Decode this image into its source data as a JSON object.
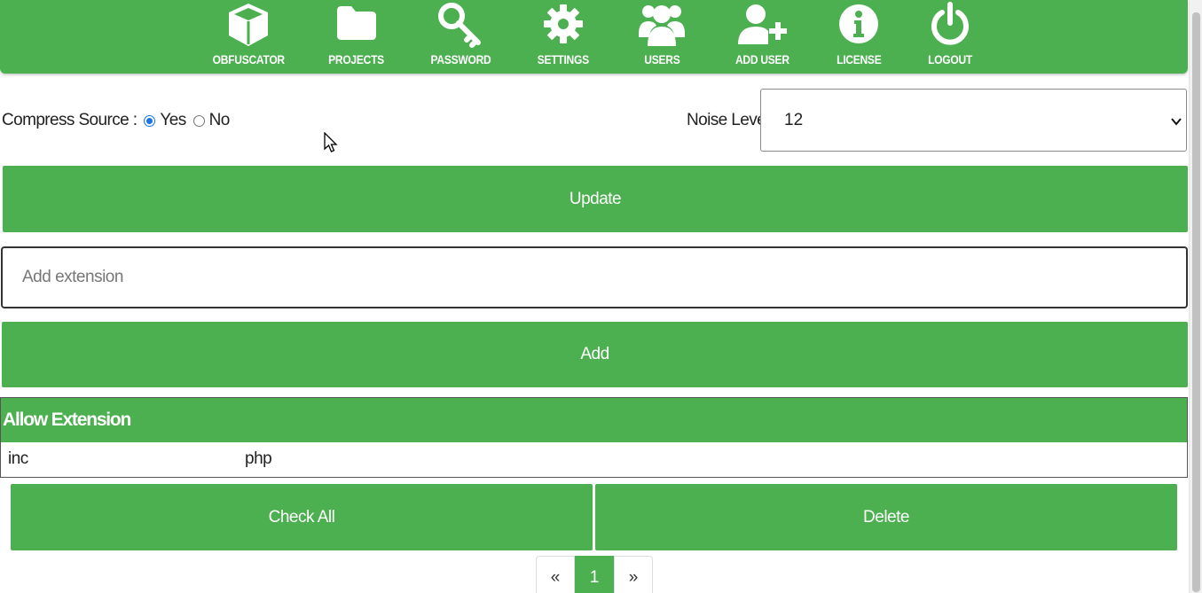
{
  "nav": {
    "items": [
      {
        "label": "OBFUSCATOR",
        "icon": "cube-icon"
      },
      {
        "label": "PROJECTS",
        "icon": "folder-icon"
      },
      {
        "label": "PASSWORD",
        "icon": "key-icon"
      },
      {
        "label": "SETTINGS",
        "icon": "gear-icon"
      },
      {
        "label": "USERS",
        "icon": "users-icon"
      },
      {
        "label": "ADD USER",
        "icon": "user-plus-icon"
      },
      {
        "label": "LICENSE",
        "icon": "info-icon"
      },
      {
        "label": "LOGOUT",
        "icon": "power-icon"
      }
    ]
  },
  "settings": {
    "compress_label": "Compress Source :",
    "compress_options": [
      {
        "label": "Yes",
        "checked": true
      },
      {
        "label": "No",
        "checked": false
      }
    ],
    "noise_label": "Noise Level :",
    "noise_value": "12",
    "update_label": "Update"
  },
  "extensions": {
    "input_placeholder": "Add extension",
    "add_label": "Add",
    "table_header": "Allow Extension",
    "items": [
      "inc",
      "php"
    ],
    "check_all_label": "Check All",
    "delete_label": "Delete"
  },
  "pagination": {
    "prev": "«",
    "current": "1",
    "next": "»"
  },
  "colors": {
    "accent": "#4caf50",
    "radio_checked": "#1a73e8"
  }
}
